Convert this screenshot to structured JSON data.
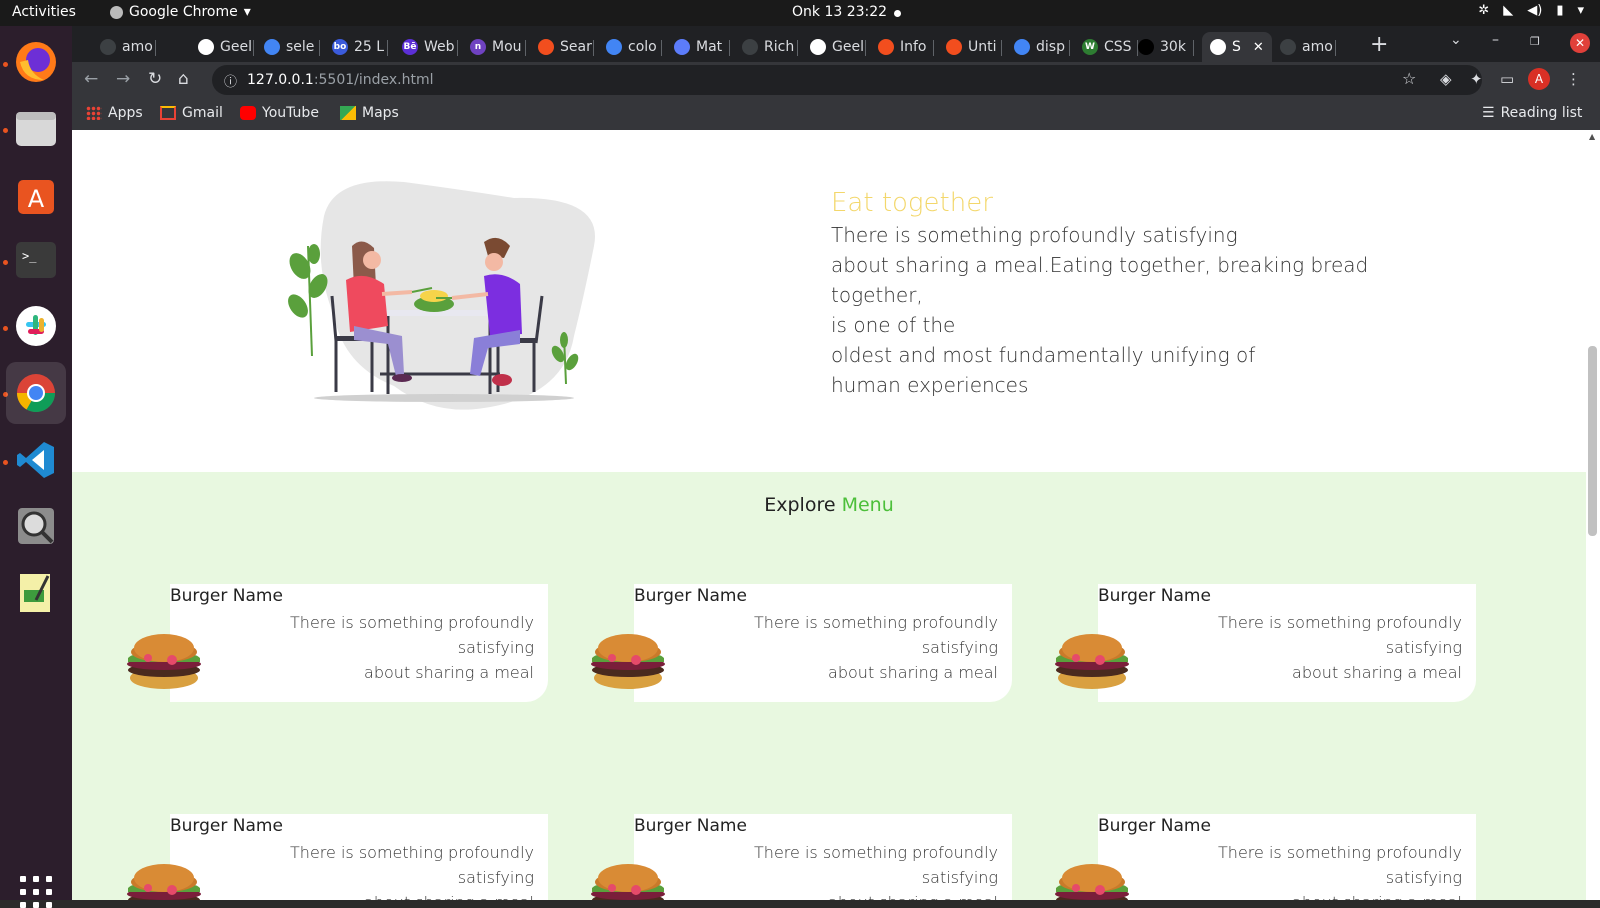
{
  "system": {
    "activities": "Activities",
    "app_name": "Google Chrome",
    "clock": "Onk 13  23:22"
  },
  "browser": {
    "tabs": [
      {
        "label": "amo",
        "fav_color": "#3c4043"
      },
      {
        "label": "Geel",
        "fav_color": "#ffffff"
      },
      {
        "label": "sele",
        "fav_color": "#4285f4"
      },
      {
        "label": "25 L",
        "fav_color": "#3b5bdb",
        "fav_text": "bo"
      },
      {
        "label": "Web",
        "fav_color": "#5c2fd6",
        "fav_text": "Bē"
      },
      {
        "label": "Mou",
        "fav_color": "#6f42c1",
        "fav_text": "n"
      },
      {
        "label": "Sear",
        "fav_color": "#f24e1e"
      },
      {
        "label": "colo",
        "fav_color": "#4285f4"
      },
      {
        "label": "Mat",
        "fav_color": "#5c7cfa"
      },
      {
        "label": "Rich",
        "fav_color": "#3c4043"
      },
      {
        "label": "Geel",
        "fav_color": "#ffffff"
      },
      {
        "label": "Info",
        "fav_color": "#f24e1e"
      },
      {
        "label": "Unti",
        "fav_color": "#f24e1e"
      },
      {
        "label": "disp",
        "fav_color": "#4285f4"
      },
      {
        "label": "CSS",
        "fav_color": "#2e7d32",
        "fav_text": "W"
      },
      {
        "label": "30k",
        "fav_color": "#000000"
      },
      {
        "label": "S",
        "fav_color": "#ffffff",
        "active": true
      },
      {
        "label": "amo",
        "fav_color": "#3c4043"
      }
    ],
    "url_host": "127.0.0.1",
    "url_path": ":5501/index.html",
    "profile_initial": "A",
    "bookmarks": [
      {
        "label": "Apps"
      },
      {
        "label": "Gmail"
      },
      {
        "label": "YouTube"
      },
      {
        "label": "Maps"
      }
    ],
    "reading_list": "Reading list"
  },
  "about": {
    "title": "Eat together",
    "lines": [
      "There is something profoundly satisfying",
      "about sharing a meal.Eating together, breaking bread",
      "together,",
      "is one of the",
      "oldest and most fundamentally unifying of",
      "human experiences"
    ]
  },
  "menu": {
    "heading_prefix": "Explore",
    "heading_accent": "Menu",
    "cards": [
      {
        "name": "Burger Name",
        "desc_line1": "There is something profoundly satisfying",
        "desc_line2": "about sharing a meal"
      },
      {
        "name": "Burger Name",
        "desc_line1": "There is something profoundly satisfying",
        "desc_line2": "about sharing a meal"
      },
      {
        "name": "Burger Name",
        "desc_line1": "There is something profoundly satisfying",
        "desc_line2": "about sharing a meal"
      },
      {
        "name": "Burger Name",
        "desc_line1": "There is something profoundly satisfying",
        "desc_line2": "about sharing a meal"
      },
      {
        "name": "Burger Name",
        "desc_line1": "There is something profoundly satisfying",
        "desc_line2": "about sharing a meal"
      },
      {
        "name": "Burger Name",
        "desc_line1": "There is something profoundly satisfying",
        "desc_line2": "about sharing a meal"
      }
    ]
  },
  "colors": {
    "accent_yellow": "#f3d76b",
    "accent_green": "#4cbf3a",
    "section_bg": "#e8f8e0"
  }
}
